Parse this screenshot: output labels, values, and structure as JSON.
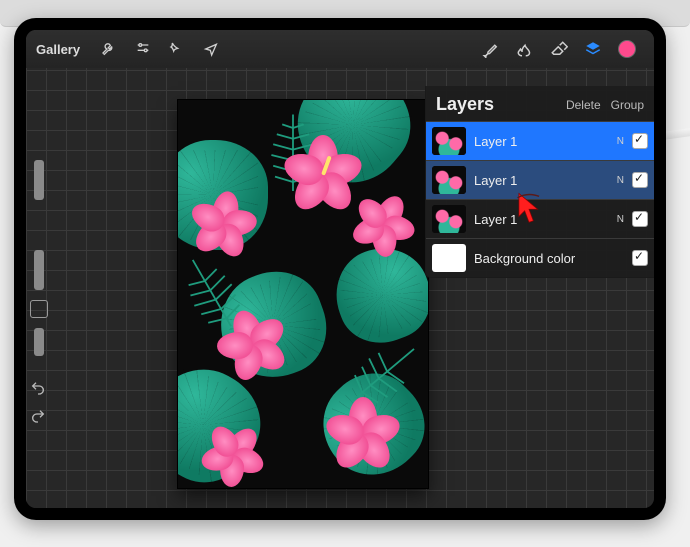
{
  "topbar": {
    "gallery": "Gallery"
  },
  "panel": {
    "title": "Layers",
    "actions": {
      "delete": "Delete",
      "group": "Group"
    }
  },
  "layers": [
    {
      "name": "Layer 1",
      "blend": "N",
      "visible": true,
      "selected": "primary",
      "thumb": "art"
    },
    {
      "name": "Layer 1",
      "blend": "N",
      "visible": true,
      "selected": "secondary",
      "thumb": "art"
    },
    {
      "name": "Layer 1",
      "blend": "N",
      "visible": true,
      "selected": "none",
      "thumb": "art"
    },
    {
      "name": "Background color",
      "blend": "",
      "visible": true,
      "selected": "none",
      "thumb": "white"
    }
  ],
  "colors": {
    "accent": "#1f77ff",
    "brush_color": "#ff4a8d",
    "layer_selected_secondary": "#2b4c7e"
  }
}
